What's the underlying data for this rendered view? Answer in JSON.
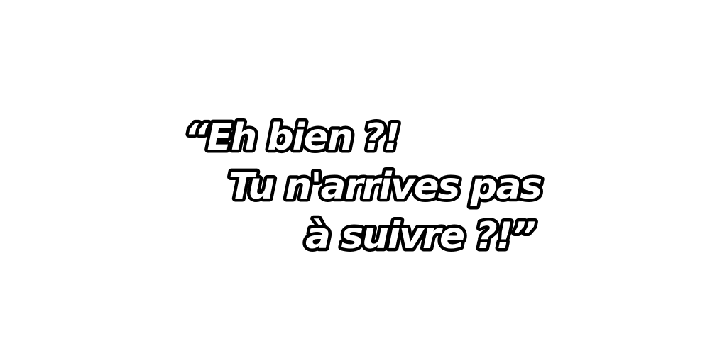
{
  "quote": {
    "line1": "“Eh bien ?!",
    "line2": "Tu n'arrives pas",
    "line3": "à suivre ?!”"
  },
  "colors": {
    "background": "#ffffff",
    "text_fill": "#ffffff",
    "text_outline": "#000000"
  }
}
